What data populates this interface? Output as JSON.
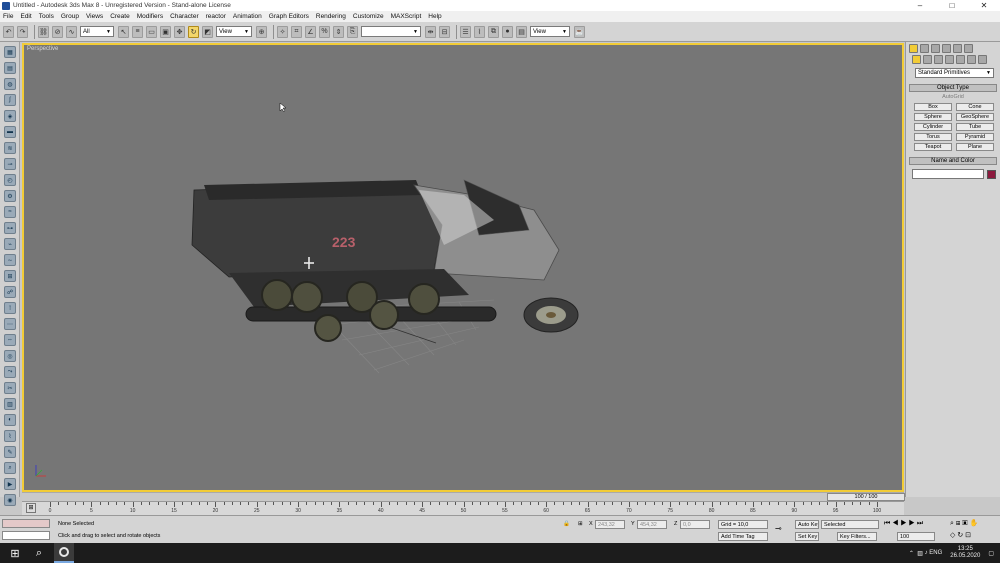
{
  "window": {
    "title": "Untitled - Autodesk 3ds Max 8 - Unregistered Version - Stand-alone License",
    "min": "–",
    "max": "□",
    "close": "✕"
  },
  "menu": [
    "File",
    "Edit",
    "Tools",
    "Group",
    "Views",
    "Create",
    "Modifiers",
    "Character",
    "reactor",
    "Animation",
    "Graph Editors",
    "Rendering",
    "Customize",
    "MAXScript",
    "Help"
  ],
  "toolbar": {
    "selection_filter": "All",
    "ref_coord": "View",
    "named_selection": "",
    "render_type": "View"
  },
  "viewport": {
    "label": "Perspective",
    "vehicle_marking": "223",
    "accent": "#f2cc36",
    "bg": "#767676"
  },
  "command_panel": {
    "category": "Standard Primitives",
    "object_type_title": "Object Type",
    "autogrid": "AutoGrid",
    "primitives": [
      "Box",
      "Cone",
      "Sphere",
      "GeoSphere",
      "Cylinder",
      "Tube",
      "Torus",
      "Pyramid",
      "Teapot",
      "Plane"
    ],
    "name_color_title": "Name and Color",
    "object_color": "#8c1a3e"
  },
  "timeline": {
    "time_slider": "100 / 100",
    "ticks": [
      "0",
      "5",
      "10",
      "15",
      "20",
      "25",
      "30",
      "35",
      "40",
      "45",
      "50",
      "55",
      "60",
      "65",
      "70",
      "75",
      "80",
      "85",
      "90",
      "95",
      "100"
    ]
  },
  "status": {
    "selection": "None Selected",
    "prompt": "Click and drag to select and rotate objects",
    "x_label": "X",
    "x_value": "243,32",
    "y_label": "Y",
    "y_value": "454,32",
    "z_label": "Z",
    "z_value": "0,0",
    "grid": "Grid = 10,0",
    "add_time_tag": "Add Time Tag",
    "auto_key": "Auto Key",
    "set_key": "Set Key",
    "key_selected": "Selected",
    "key_filters": "Key Filters...",
    "frame": "100"
  },
  "taskbar": {
    "start": "⊞",
    "search": "⌕",
    "time": "13:25",
    "date": "26.05.2020",
    "lang": "ENG"
  }
}
